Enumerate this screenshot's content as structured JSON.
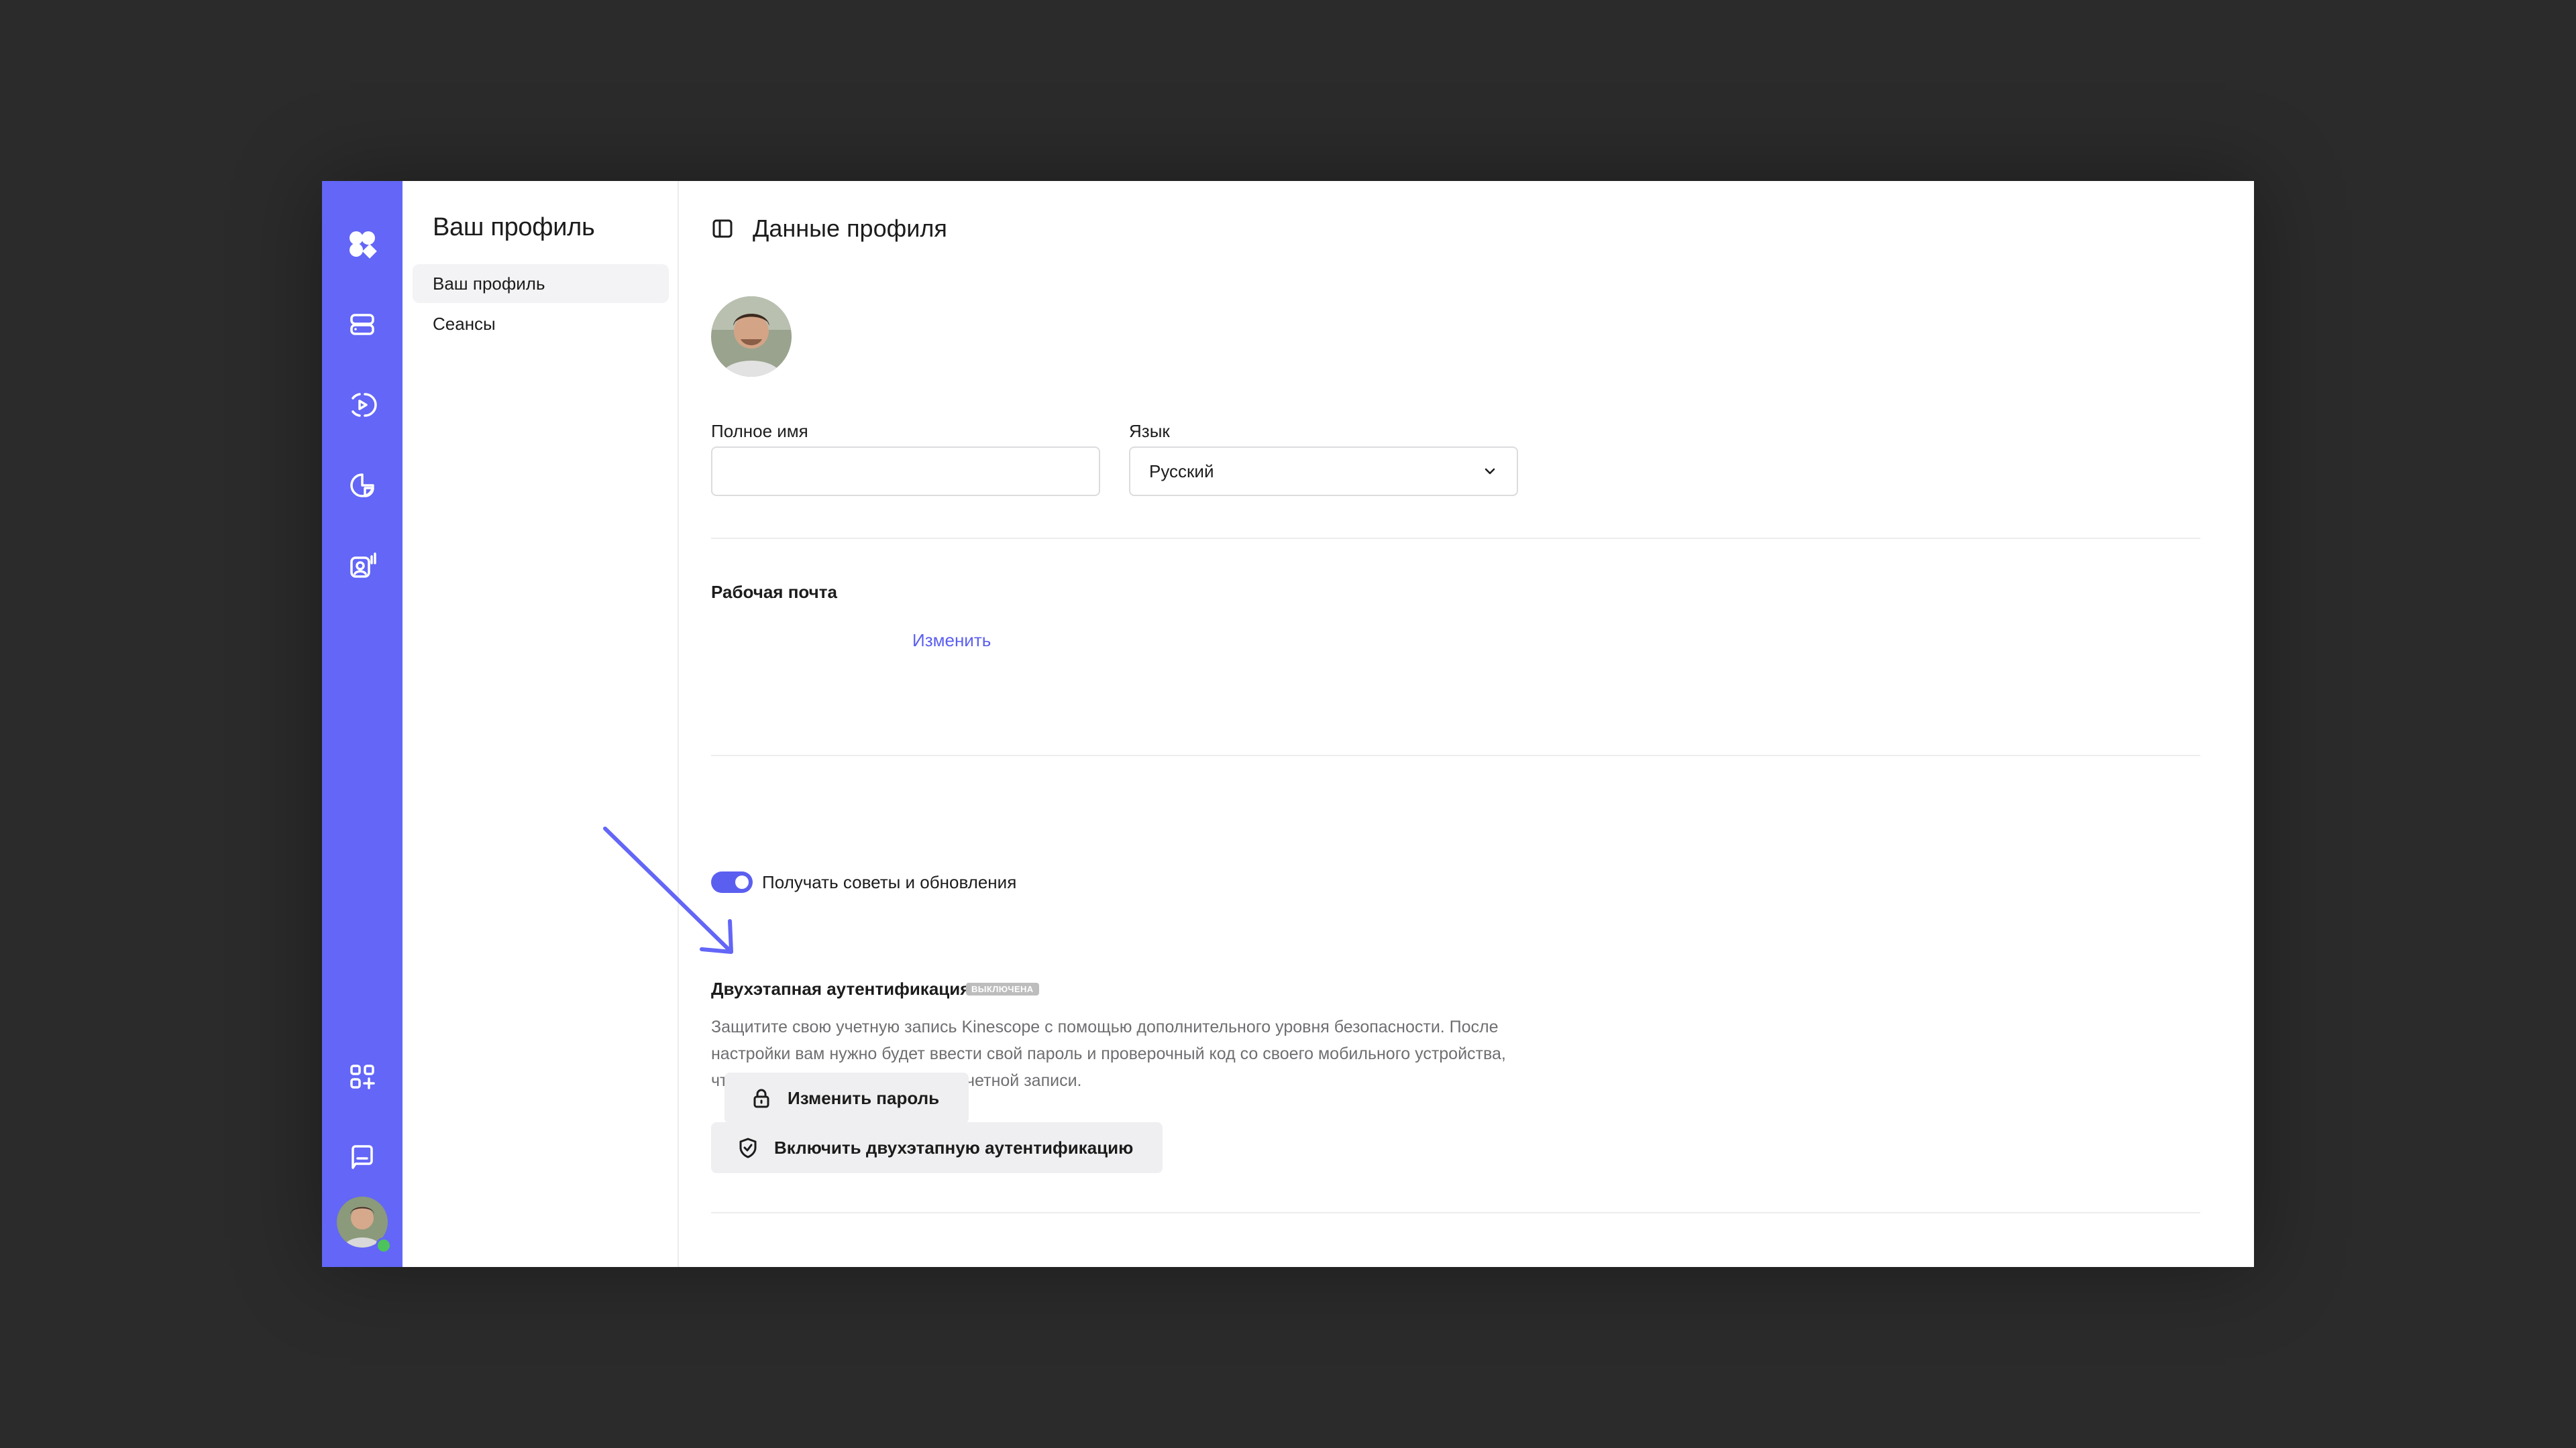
{
  "colors": {
    "accent": "#6366f6",
    "link": "#5b5ff0",
    "background": "#2b2b2b",
    "annotation_arrow": "#6366f6"
  },
  "rail": {
    "logo_icon": "kinescope-logo-icon",
    "items": [
      {
        "icon": "storage-icon"
      },
      {
        "icon": "broadcast-icon"
      },
      {
        "icon": "analytics-icon"
      },
      {
        "icon": "audience-icon"
      }
    ],
    "bottom_items": [
      {
        "icon": "apps-add-icon"
      },
      {
        "icon": "chat-icon"
      }
    ],
    "avatar_status": "online"
  },
  "sidebar": {
    "title": "Ваш профиль",
    "items": [
      {
        "label": "Ваш профиль",
        "active": true
      },
      {
        "label": "Сеансы",
        "active": false
      }
    ]
  },
  "main": {
    "title": "Данные профиля",
    "full_name": {
      "label": "Полное имя",
      "value": "",
      "placeholder": ""
    },
    "language": {
      "label": "Язык",
      "value": "Русский"
    },
    "email": {
      "label": "Рабочая почта",
      "change_link": "Изменить"
    },
    "newsletter": {
      "label": "Получать советы и обновления",
      "enabled": true
    },
    "two_factor": {
      "title": "Двухэтапная аутентификация",
      "badge": "выключена",
      "description": "Защитите свою учетную запись Kinescope с помощью дополнительного уровня безопасности. После настройки вам нужно будет ввести свой пароль и проверочный код со своего мобильного устройства, чтобы получить доступ к своей учетной записи.",
      "button": "Включить двухэтапную аутентификацию"
    },
    "password": {
      "button": "Изменить пароль"
    }
  }
}
